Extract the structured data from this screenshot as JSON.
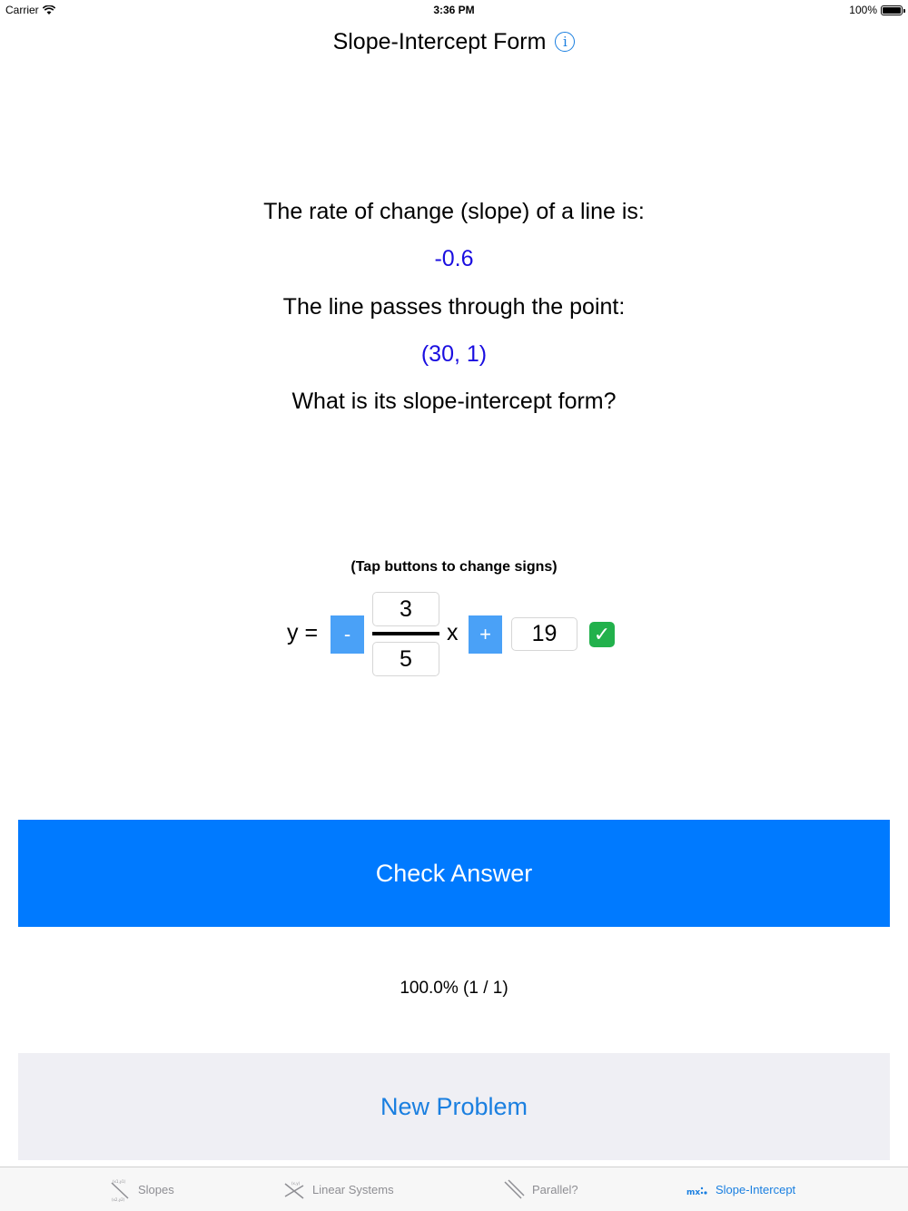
{
  "status_bar": {
    "carrier": "Carrier",
    "time": "3:36 PM",
    "battery": "100%"
  },
  "nav": {
    "title": "Slope-Intercept Form",
    "info_icon": "info-icon"
  },
  "problem": {
    "line1": "The rate of change (slope) of a line is:",
    "slope_value": "-0.6",
    "line2": "The line passes through the point:",
    "point_value": "(30, 1)",
    "line3": "What is its slope-intercept form?"
  },
  "equation": {
    "hint": "(Tap buttons to change signs)",
    "y_label": "y =",
    "slope_sign": "-",
    "numerator": "3",
    "denominator": "5",
    "x_label": "x",
    "intercept_sign": "+",
    "intercept": "19",
    "status_icon": "check-mark-icon"
  },
  "actions": {
    "check_label": "Check Answer",
    "score": "100.0% (1 / 1)",
    "new_label": "New Problem"
  },
  "tabs": [
    {
      "label": "Slopes",
      "icon": "slopes-icon",
      "active": false
    },
    {
      "label": "Linear Systems",
      "icon": "linear-systems-icon",
      "active": false
    },
    {
      "label": "Parallel?",
      "icon": "parallel-icon",
      "active": false
    },
    {
      "label": "Slope-Intercept",
      "icon": "slope-intercept-icon",
      "active": true
    }
  ],
  "colors": {
    "accent": "#007aff",
    "value_blue": "#1a0ee0",
    "sign_button": "#4aa1f7",
    "secondary_button": "#efeff4"
  }
}
